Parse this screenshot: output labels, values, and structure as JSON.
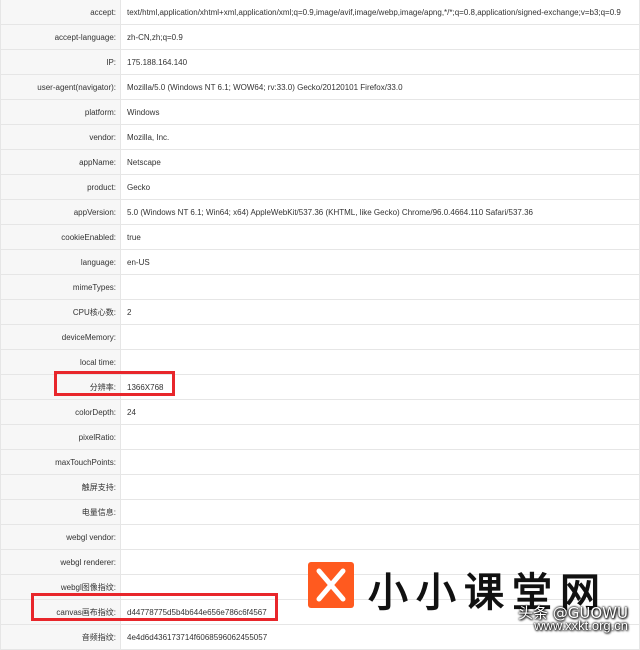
{
  "rows": [
    {
      "key": "accept:",
      "value": "text/html,application/xhtml+xml,application/xml;q=0.9,image/avif,image/webp,image/apng,*/*;q=0.8,application/signed-exchange;v=b3;q=0.9"
    },
    {
      "key": "accept-language:",
      "value": "zh-CN,zh;q=0.9"
    },
    {
      "key": "IP:",
      "value": "175.188.164.140"
    },
    {
      "key": "user-agent(navigator):",
      "value": "Mozilla/5.0 (Windows NT 6.1; WOW64; rv:33.0) Gecko/20120101 Firefox/33.0"
    },
    {
      "key": "platform:",
      "value": "Windows"
    },
    {
      "key": "vendor:",
      "value": "Mozilla, Inc."
    },
    {
      "key": "appName:",
      "value": "Netscape"
    },
    {
      "key": "product:",
      "value": "Gecko"
    },
    {
      "key": "appVersion:",
      "value": "5.0 (Windows NT 6.1; Win64; x64) AppleWebKit/537.36 (KHTML, like Gecko) Chrome/96.0.4664.110 Safari/537.36"
    },
    {
      "key": "cookieEnabled:",
      "value": "true"
    },
    {
      "key": "language:",
      "value": "en-US"
    },
    {
      "key": "mimeTypes:",
      "value": ""
    },
    {
      "key": "CPU核心数:",
      "value": "2"
    },
    {
      "key": "deviceMemory:",
      "value": ""
    },
    {
      "key": "local time:",
      "value": ""
    },
    {
      "key": "分辨率:",
      "value": "1366X768"
    },
    {
      "key": "colorDepth:",
      "value": "24"
    },
    {
      "key": "pixelRatio:",
      "value": ""
    },
    {
      "key": "maxTouchPoints:",
      "value": ""
    },
    {
      "key": "触屏支持:",
      "value": ""
    },
    {
      "key": "电量信息:",
      "value": ""
    },
    {
      "key": "webgl vendor:",
      "value": ""
    },
    {
      "key": "webgl renderer:",
      "value": ""
    },
    {
      "key": "webgl图像指纹:",
      "value": ""
    },
    {
      "key": "canvas画布指纹:",
      "value": "d44778775d5b4b644e656e786c6f4567"
    },
    {
      "key": "音频指纹:",
      "value": "4e4d6d436173714f6068596062455057"
    }
  ],
  "watermark": {
    "icon": "x-logo-icon",
    "brand": "小小课堂网",
    "credit": "头条 @GUOWU",
    "site": "www.xxkt.org.cn",
    "accent": "#ff5a1f"
  },
  "highlight_color": "#e8262b"
}
